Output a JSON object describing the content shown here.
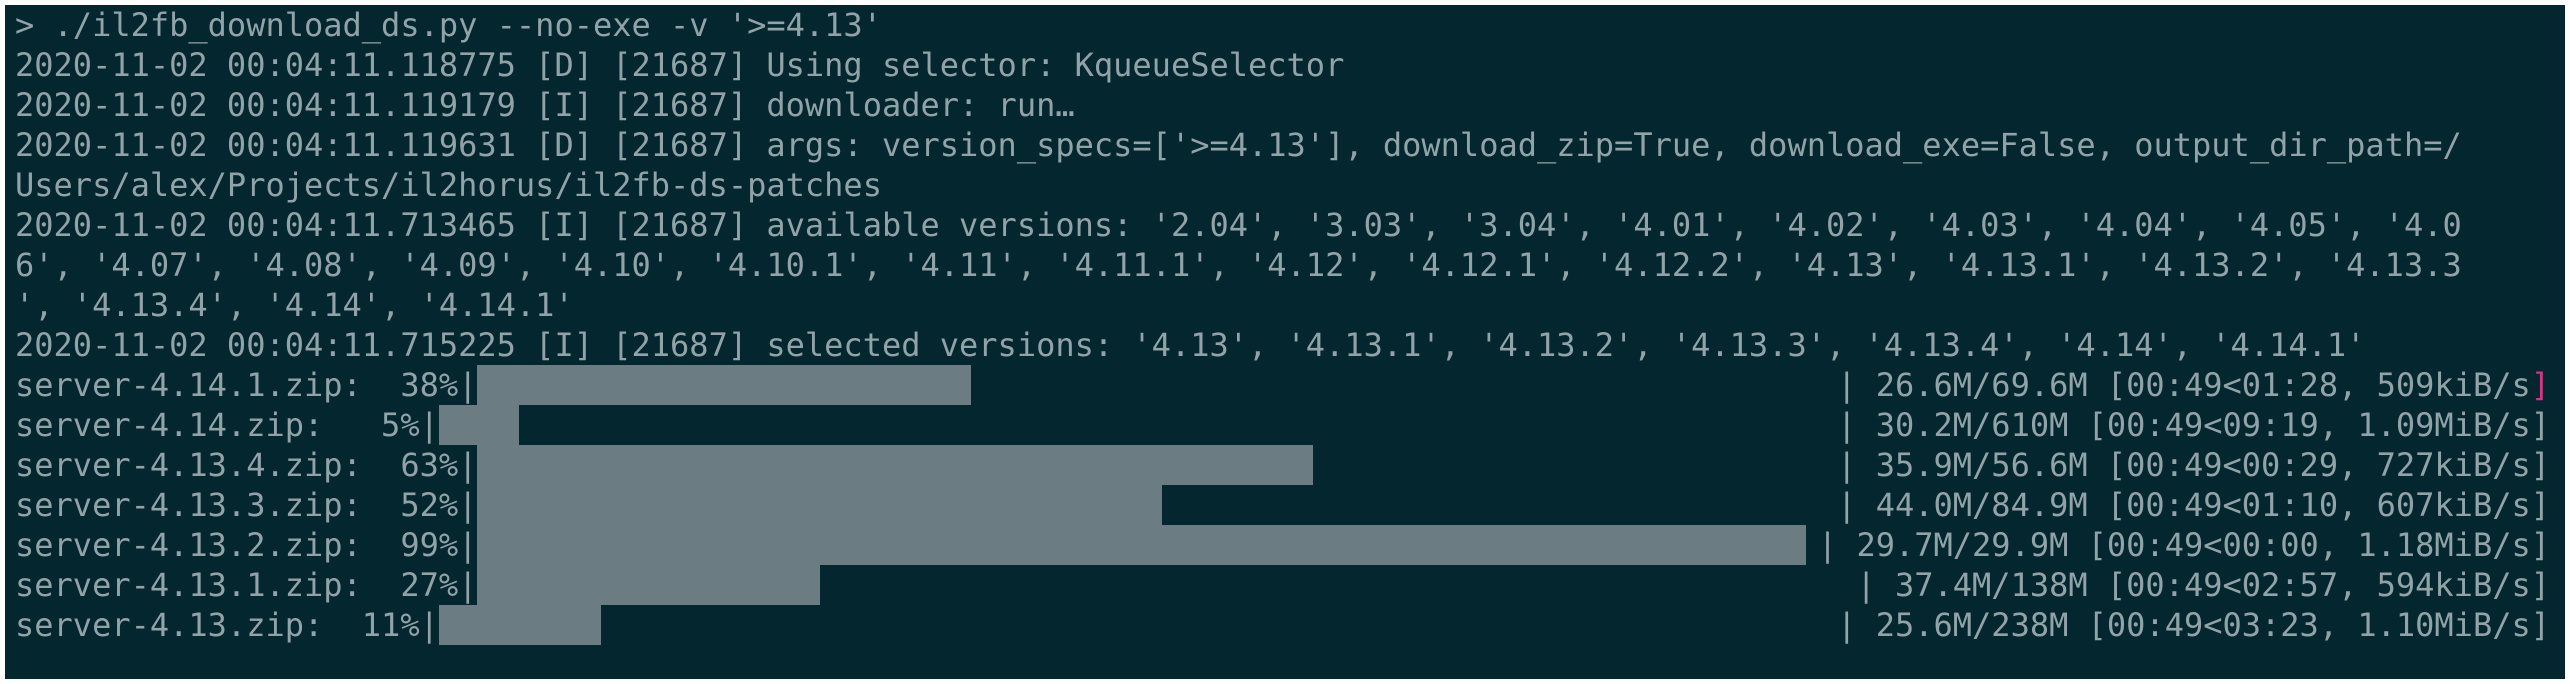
{
  "terminal": {
    "lines": [
      "> ./il2fb_download_ds.py --no-exe -v '>=4.13'",
      "2020-11-02 00:04:11.118775 [D] [21687] Using selector: KqueueSelector",
      "2020-11-02 00:04:11.119179 [I] [21687] downloader: run…",
      "2020-11-02 00:04:11.119631 [D] [21687] args: version_specs=['>=4.13'], download_zip=True, download_exe=False, output_dir_path=/",
      "Users/alex/Projects/il2horus/il2fb-ds-patches",
      "2020-11-02 00:04:11.713465 [I] [21687] available versions: '2.04', '3.03', '3.04', '4.01', '4.02', '4.03', '4.04', '4.05', '4.0",
      "6', '4.07', '4.08', '4.09', '4.10', '4.10.1', '4.11', '4.11.1', '4.12', '4.12.1', '4.12.2', '4.13', '4.13.1', '4.13.2', '4.13.3",
      "', '4.13.4', '4.14', '4.14.1'",
      "2020-11-02 00:04:11.715225 [I] [21687] selected versions: '4.13', '4.13.1', '4.13.2', '4.13.3', '4.13.4', '4.14', '4.14.1'"
    ],
    "downloads": [
      {
        "prefix": "server-4.14.1.zip:  38%|",
        "percent": 38,
        "stats": "| 26.6M/69.6M [00:49<01:28, 509kiB/s",
        "tail": "]",
        "cursor": true
      },
      {
        "prefix": "server-4.14.zip:   5%|",
        "percent": 5,
        "stats": "| 30.2M/610M [00:49<09:19, 1.09MiB/s]",
        "tail": "",
        "cursor": false
      },
      {
        "prefix": "server-4.13.4.zip:  63%|",
        "percent": 63,
        "stats": "| 35.9M/56.6M [00:49<00:29, 727kiB/s]",
        "tail": "",
        "cursor": false
      },
      {
        "prefix": "server-4.13.3.zip:  52%|",
        "percent": 52,
        "stats": "| 44.0M/84.9M [00:49<01:10, 607kiB/s]",
        "tail": "",
        "cursor": false
      },
      {
        "prefix": "server-4.13.2.zip:  99%|",
        "percent": 99,
        "stats": "| 29.7M/29.9M [00:49<00:00, 1.18MiB/s]",
        "tail": "",
        "cursor": false
      },
      {
        "prefix": "server-4.13.1.zip:  27%|",
        "percent": 27,
        "stats": "| 37.4M/138M [00:49<02:57, 594kiB/s]",
        "tail": "",
        "cursor": false
      },
      {
        "prefix": "server-4.13.zip:  11%|",
        "percent": 11,
        "stats": "| 25.6M/238M [00:49<03:23, 1.10MiB/s]",
        "tail": "",
        "cursor": false
      }
    ],
    "colors": {
      "background": "#04262f",
      "text": "#8fa3a8",
      "bar": "#6b7c82",
      "cursor": "#d33682"
    }
  }
}
